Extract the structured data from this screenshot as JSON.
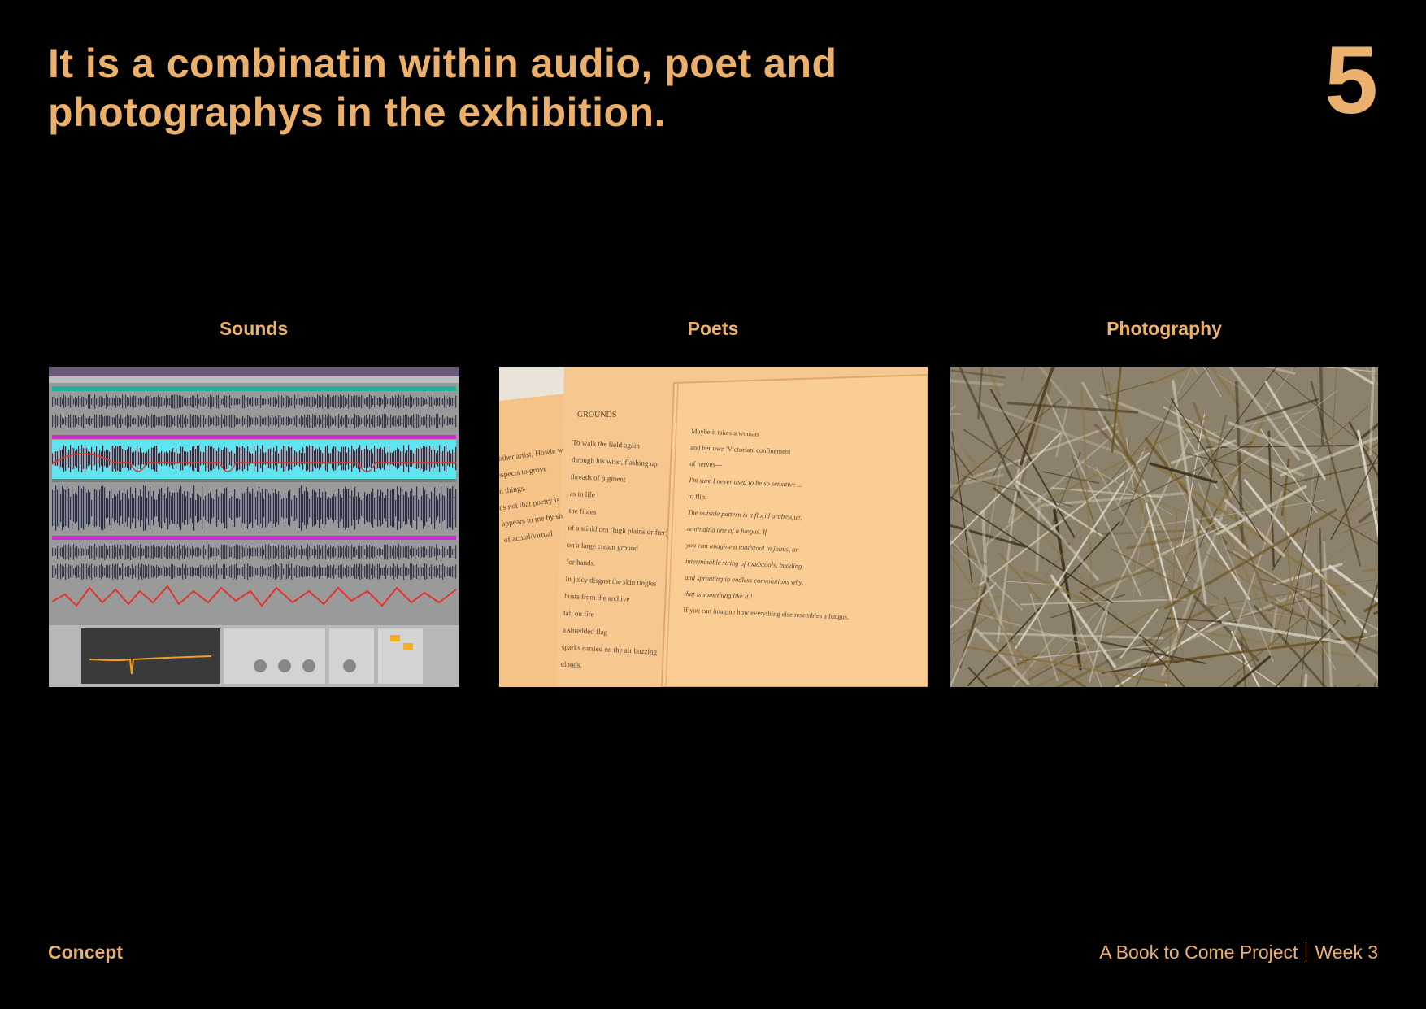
{
  "slide": {
    "title": "It is a combinatin within audio, poet and photographys in the exhibition.",
    "page_number": "5"
  },
  "columns": [
    {
      "heading": "Sounds",
      "image": "daw-audio-editor-screenshot"
    },
    {
      "heading": "Poets",
      "image": "poem-pages-photo"
    },
    {
      "heading": "Photography",
      "image": "abstract-texture-photo"
    }
  ],
  "poem": {
    "title": "GROUNDS",
    "left_fragments": [
      "n other artist, Howie w",
      "respects to grove",
      "in things.",
      "t's not that poetry is",
      "appears to me by sh",
      "of actual/virtual"
    ],
    "middle_lines": [
      "To walk the field again",
      "through his wrist, flashing up",
      "threads of pigment",
      "as in life",
      "the fibres",
      "of a stinkhorn (high plains drifter)",
      "on a large cream ground",
      "for hands.",
      "In juicy disgust the skin tingles",
      "busts from the archive",
      "tall on fire",
      "a shredded flag",
      "sparks carried on the air buzzing",
      "clouds."
    ],
    "right_lines": [
      "Maybe it takes a woman",
      "and her own 'Victorian' confinement",
      "of nerves—",
      "I'm sure I never used to be so sensitive ...",
      "to flip.",
      "The outside pattern is a florid arabesque,",
      "reminding one of a fungus. If",
      "you can imagine a toadstool in joints, an",
      "interminable string of toadstools, budding",
      "and sprouting in endless convolutions why,",
      "that is something like it.¹",
      "If you can imagine how everything else resembles a fungus."
    ]
  },
  "footer": {
    "section": "Concept",
    "project": "A Book to Come Project",
    "week": "Week 3"
  },
  "colors": {
    "background": "#000000",
    "accent": "#ebb06c"
  }
}
